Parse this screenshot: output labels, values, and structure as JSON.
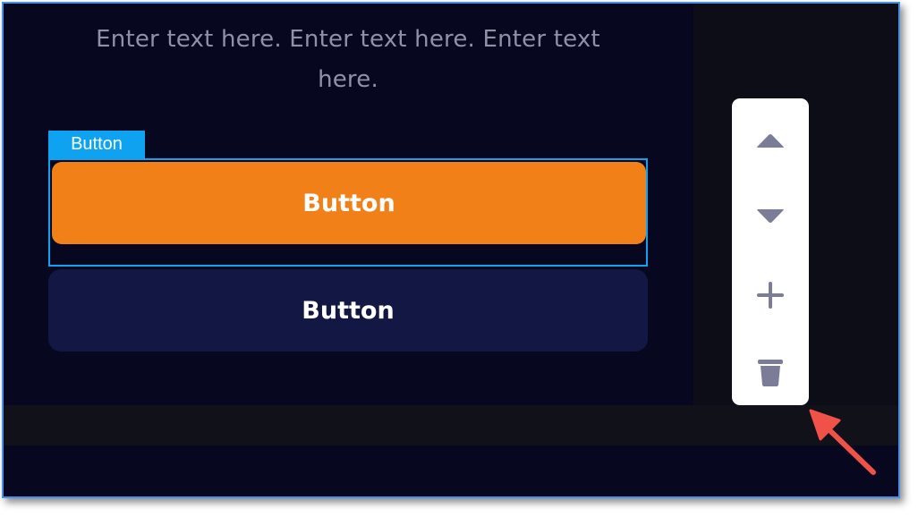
{
  "canvas": {
    "body_text": "Enter text here. Enter text here. Enter text here."
  },
  "selection": {
    "tag_label": "Button"
  },
  "buttons": {
    "primary_label": "Button",
    "secondary_label": "Button"
  },
  "toolbar": {
    "items": [
      {
        "icon": "move-up-icon"
      },
      {
        "icon": "move-down-icon"
      },
      {
        "icon": "add-icon"
      },
      {
        "icon": "trash-icon"
      }
    ]
  },
  "colors": {
    "accent_orange": "#f28019",
    "selection_blue": "#0ea2f0",
    "secondary_button": "#131743",
    "canvas_bg": "#07071f",
    "icon_gray": "#7a7c98",
    "annotation_arrow": "#f0524a",
    "frame_border": "#4a8fe7"
  }
}
